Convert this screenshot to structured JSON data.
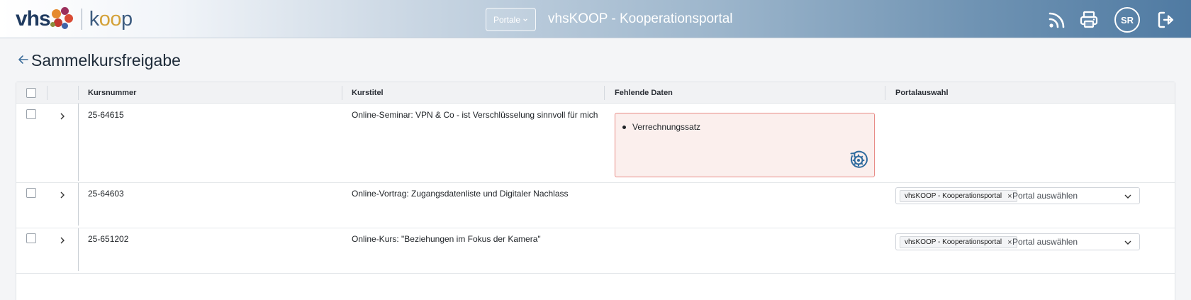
{
  "header": {
    "logo_main": "vhs",
    "logo_koop_k": "k",
    "logo_koop_oo": "oo",
    "logo_koop_p": "p",
    "portal_button": "Portale",
    "app_title": "vhsKOOP - Kooperationsportal",
    "avatar_initials": "SR",
    "icons": [
      "rss-icon",
      "printer-icon",
      "logout-icon",
      "chevron-down-icon"
    ]
  },
  "page": {
    "title": "Sammelkursfreigabe"
  },
  "table": {
    "columns": {
      "kursnummer": "Kursnummer",
      "kurstitel": "Kurstitel",
      "fehlende_daten": "Fehlende Daten",
      "portalauswahl": "Portalauswahl"
    },
    "rows": [
      {
        "kursnummer": "25-64615",
        "kurstitel": "Online-Seminar: VPN & Co - ist Verschlüsselung sinnvoll für mich",
        "fehlende_daten": [
          "Verrechnungssatz"
        ]
      },
      {
        "kursnummer": "25-64603",
        "kurstitel": "Online-Vortrag: Zugangsdatenliste und Digitaler Nachlass",
        "portal_tag": "vhsKOOP - Kooperationsportal",
        "portal_tag_remove": "×",
        "portal_placeholder": "Portal auswählen"
      },
      {
        "kursnummer": "25-651202",
        "kurstitel": "Online-Kurs: \"Beziehungen im Fokus der Kamera\"",
        "portal_tag": "vhsKOOP - Kooperationsportal",
        "portal_tag_remove": "×",
        "portal_placeholder": "Portal auswählen"
      }
    ]
  },
  "colors": {
    "header_start": "#ffffff",
    "header_end": "#4f7aa2",
    "missing_bg": "#fbefed",
    "missing_border": "#e88b86",
    "gear_accent": "#2f6b9e"
  }
}
